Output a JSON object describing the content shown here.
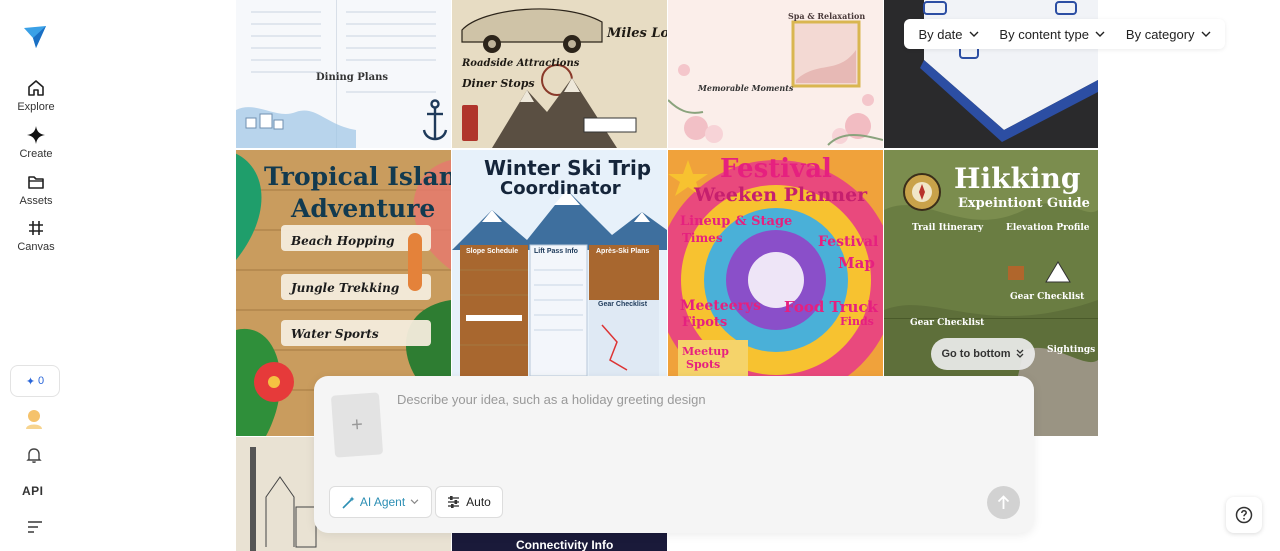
{
  "nav": {
    "items": [
      {
        "label": "Explore",
        "icon": "home-icon"
      },
      {
        "label": "Create",
        "icon": "sparkle-icon"
      },
      {
        "label": "Assets",
        "icon": "folder-icon"
      },
      {
        "label": "Canvas",
        "icon": "frame-icon"
      }
    ],
    "credits": "0",
    "api_label": "API"
  },
  "filters": {
    "by_date": "By date",
    "by_content_type": "By content type",
    "by_category": "By category"
  },
  "gallery": {
    "dining": {
      "title": "Dining Plans"
    },
    "miles": {
      "title": "Miles Log",
      "line1": "Roadside Attractions",
      "line2": "Diner Stops"
    },
    "memorable": {
      "title": "Spa & Relaxation",
      "line1": "Memorable Moments"
    },
    "tropical": {
      "title1": "Tropical Island",
      "title2": "Adventure",
      "i1": "Beach Hopping",
      "i2": "Jungle Trekking",
      "i3": "Water Sports"
    },
    "ski": {
      "title1": "Winter Ski Trip",
      "title2": "Coordinator",
      "c1": "Slope Schedule",
      "c2": "Lift Pass Info",
      "c3": "Après-Ski Plans",
      "c4": "Gear Checklist"
    },
    "festival": {
      "title1": "Festival",
      "title2": "Weeken Planner",
      "l1": "Lineup & Stage",
      "l2": "Times",
      "l3": "Festival",
      "l4": "Map",
      "l5": "Meeteerys",
      "l6": "Fipots",
      "l7": "Food Truck",
      "l8": "Finds",
      "l9": "Meetup",
      "l10": "Spots"
    },
    "hiking": {
      "title1": "Hikking",
      "title2": "Expeintiont Guide",
      "h1": "Trail Itinerary",
      "h2": "Elevation Profile",
      "h3": "Gear Checklist",
      "h4": "Gear Checklist",
      "h5": "Sightings"
    },
    "connectivity": {
      "title": "Connectivity Info"
    }
  },
  "goto_bottom": "Go to bottom",
  "prompt": {
    "placeholder": "Describe your idea, such as a holiday greeting design",
    "agent_label": "AI Agent",
    "auto_label": "Auto"
  },
  "colors": {
    "accent": "#2a66d9",
    "agent_teal": "#2d8fb4"
  }
}
